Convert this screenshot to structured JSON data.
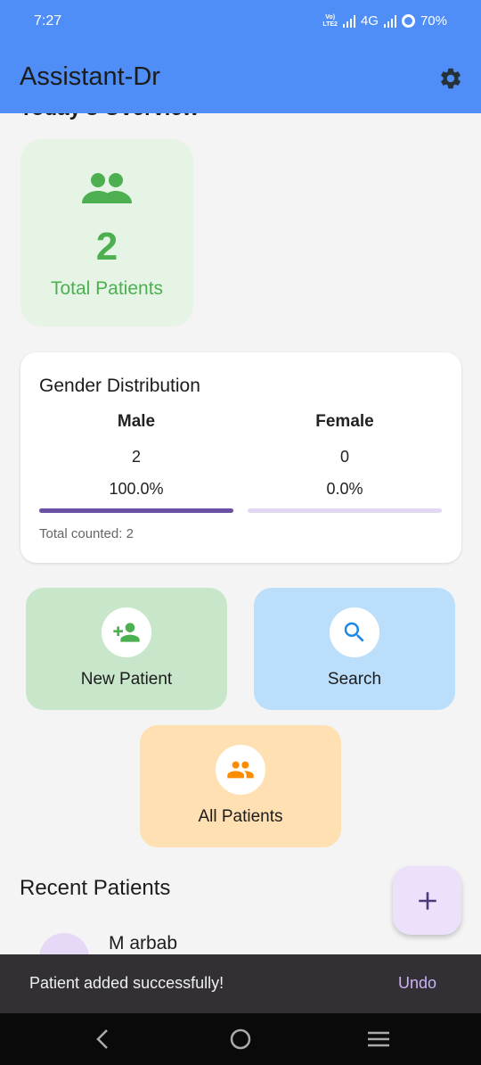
{
  "status_bar": {
    "time": "7:27",
    "network": "4G",
    "battery": "70%"
  },
  "app_bar": {
    "title": "Assistant-Dr",
    "settings_icon": "gear-icon"
  },
  "overview": {
    "title": "Today's Overview",
    "total_patients": {
      "value": "2",
      "label": "Total Patients",
      "icon": "people-icon",
      "color": "#4caf50"
    }
  },
  "gender": {
    "title": "Gender Distribution",
    "male": {
      "label": "Male",
      "count": "2",
      "percent_text": "100.0%",
      "fraction": 1.0,
      "color": "#6a4fa3"
    },
    "female": {
      "label": "Female",
      "count": "0",
      "percent_text": "0.0%",
      "fraction": 0.0,
      "color": "#e3d8f3"
    },
    "total_counted": "Total counted: 2"
  },
  "actions": {
    "new_patient": {
      "label": "New Patient",
      "icon": "person-add-icon",
      "bg": "#c8e6c9",
      "color": "#4caf50"
    },
    "search": {
      "label": "Search",
      "icon": "search-icon",
      "bg": "#bbdefb",
      "color": "#1e88e5"
    },
    "all_patients": {
      "label": "All Patients",
      "icon": "people-icon",
      "bg": "#ffe0b2",
      "color": "#fb8c00"
    }
  },
  "recent": {
    "title": "Recent Patients",
    "patients": [
      {
        "name": "M arbab"
      }
    ]
  },
  "fab": {
    "icon": "plus-icon"
  },
  "snackbar": {
    "message": "Patient added successfully!",
    "action": "Undo"
  },
  "nav": {
    "back_icon": "back-icon",
    "home_icon": "home-icon",
    "recents_icon": "menu-icon"
  }
}
